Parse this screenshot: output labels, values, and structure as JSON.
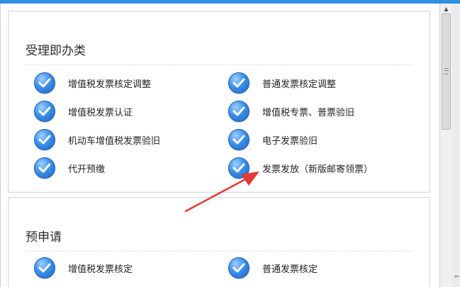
{
  "sections": [
    {
      "title": "受理即办类",
      "items": [
        {
          "label": "增值税发票核定调整"
        },
        {
          "label": "普通发票核定调整"
        },
        {
          "label": "增值税发票认证"
        },
        {
          "label": "增值税专票、普票验旧"
        },
        {
          "label": "机动车增值税发票验旧"
        },
        {
          "label": "电子发票验旧"
        },
        {
          "label": "代开预缴"
        },
        {
          "label": "发票发放（新版邮寄领票）"
        }
      ]
    },
    {
      "title": "预申请",
      "items": [
        {
          "label": "增值税发票核定"
        },
        {
          "label": "普通发票核定"
        }
      ]
    }
  ],
  "icons": {
    "item": "check-circle-icon",
    "annotation": "red-arrow-icon"
  },
  "colors": {
    "accent": "#2f8fe0",
    "check": "#2f7fdc",
    "annotation": "#e53935"
  }
}
